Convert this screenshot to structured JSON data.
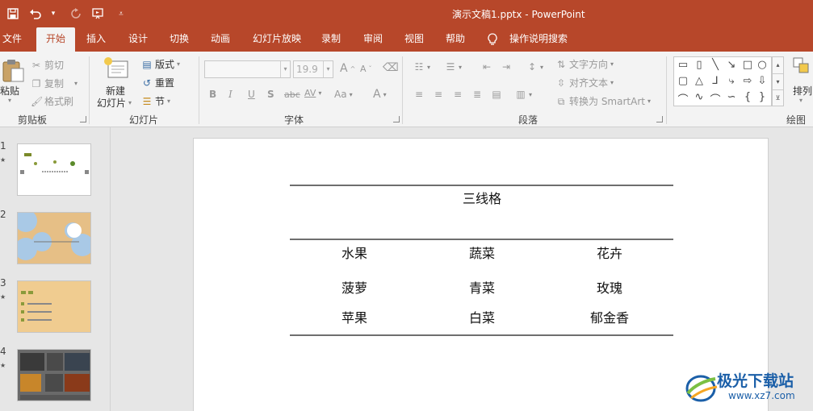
{
  "window": {
    "title": "演示文稿1.pptx  -  PowerPoint",
    "accent": "#b7472a"
  },
  "qat": {
    "save_icon": "save-icon",
    "undo_icon": "undo-icon",
    "redo_icon": "redo-icon",
    "present_icon": "start-from-beginning-icon"
  },
  "tabs": [
    {
      "label": "文件"
    },
    {
      "label": "开始"
    },
    {
      "label": "插入"
    },
    {
      "label": "设计"
    },
    {
      "label": "切换"
    },
    {
      "label": "动画"
    },
    {
      "label": "幻灯片放映"
    },
    {
      "label": "录制"
    },
    {
      "label": "审阅"
    },
    {
      "label": "视图"
    },
    {
      "label": "帮助"
    },
    {
      "label": "操作说明搜索"
    }
  ],
  "ribbon": {
    "clipboard": {
      "paste": "粘贴",
      "cut": "剪切",
      "copy": "复制",
      "format_painter": "格式刷",
      "group": "剪贴板"
    },
    "slides": {
      "new_slide_line1": "新建",
      "new_slide_line2": "幻灯片",
      "layout": "版式",
      "reset": "重置",
      "section": "节",
      "group": "幻灯片"
    },
    "font": {
      "font_name": "",
      "font_size": "19.9",
      "bold": "B",
      "italic": "I",
      "underline": "U",
      "shadow": "S",
      "strike": "abc",
      "spacing": "AV",
      "case": "Aa",
      "color": "A",
      "grow": "A",
      "shrink": "A",
      "group": "字体"
    },
    "paragraph": {
      "text_direction": "文字方向",
      "align_text": "对齐文本",
      "smartart": "转换为 SmartArt",
      "group": "段落"
    },
    "drawing": {
      "arrange": "排列",
      "group": "绘图"
    }
  },
  "slides": [
    {
      "number": "1",
      "star": "★"
    },
    {
      "number": "2",
      "star": ""
    },
    {
      "number": "3",
      "star": "★"
    },
    {
      "number": "4",
      "star": "★"
    }
  ],
  "table": {
    "caption": "三线格",
    "headers": [
      "水果",
      "蔬菜",
      "花卉"
    ],
    "rows": [
      [
        "菠萝",
        "青菜",
        "玫瑰"
      ],
      [
        "苹果",
        "白菜",
        "郁金香"
      ]
    ]
  },
  "watermark": {
    "name": "极光下载站",
    "url": "www.xz7.com"
  }
}
